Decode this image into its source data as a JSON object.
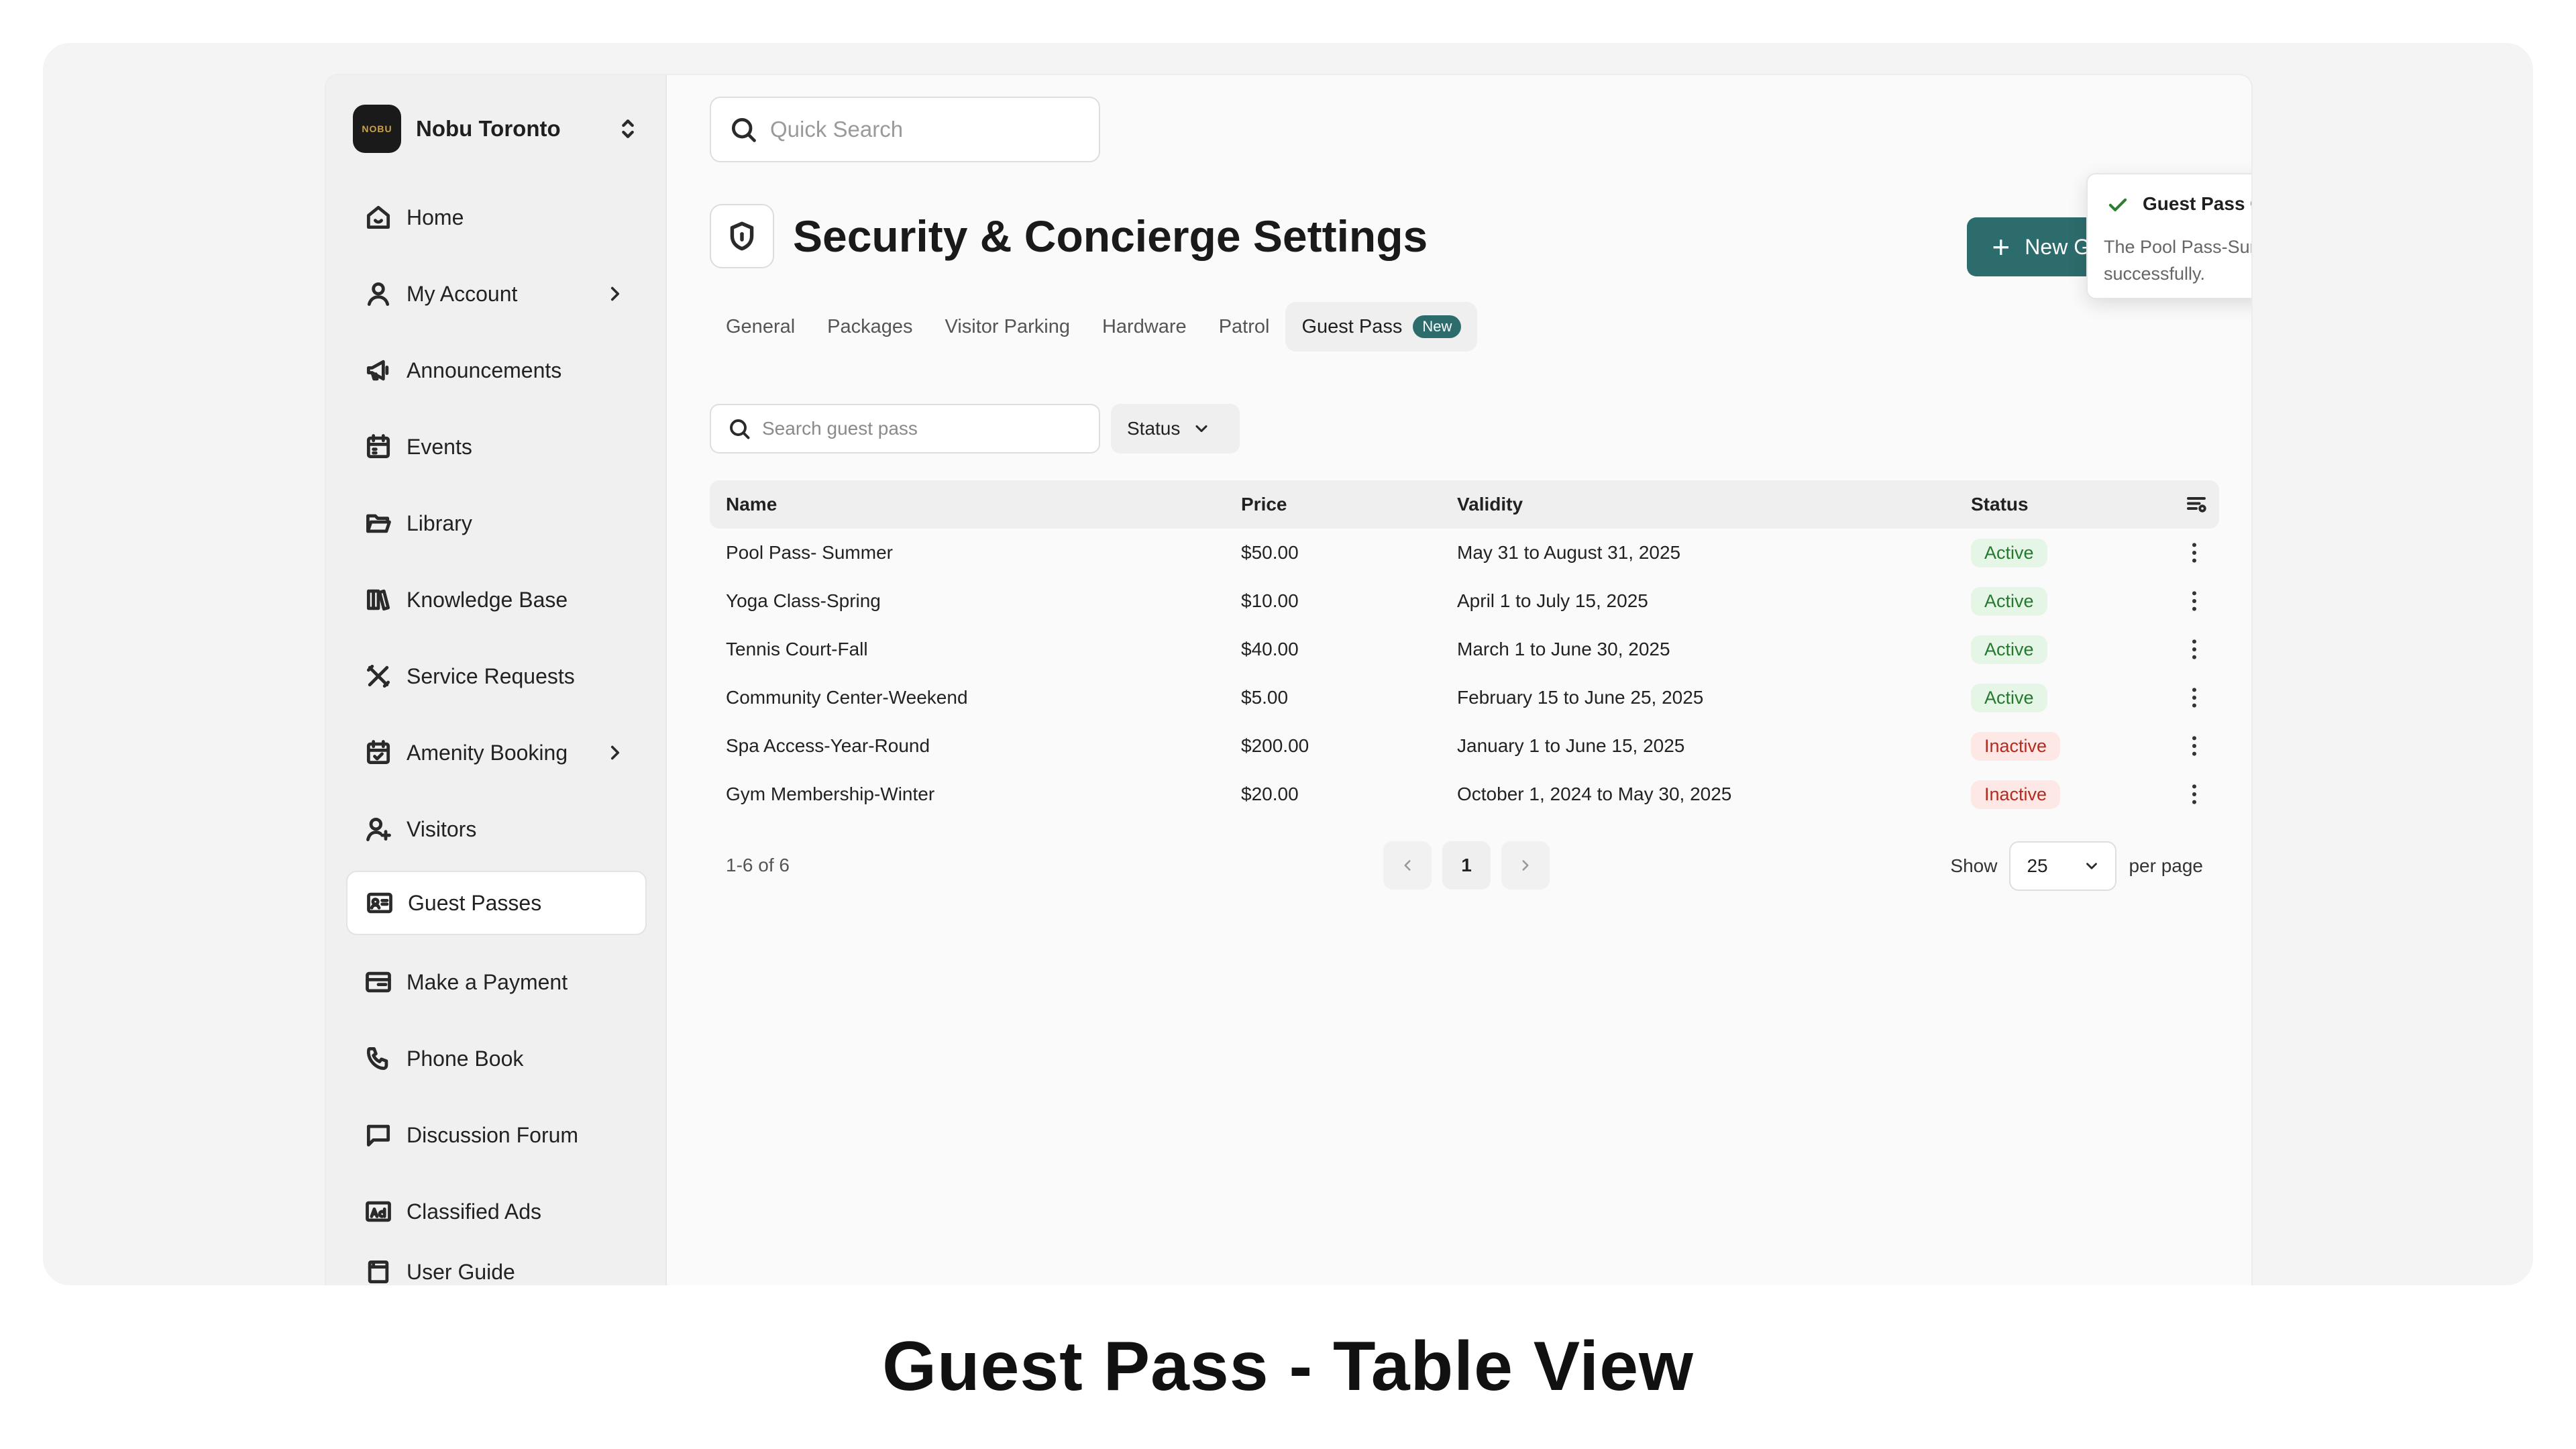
{
  "org": {
    "name": "Nobu Toronto",
    "logo_text": "NOBU"
  },
  "sidebar": {
    "items": [
      {
        "label": "Home",
        "icon": "home-icon",
        "chevron": false,
        "active": false
      },
      {
        "label": "My Account",
        "icon": "user-icon",
        "chevron": true,
        "active": false
      },
      {
        "label": "Announcements",
        "icon": "megaphone-icon",
        "chevron": false,
        "active": false
      },
      {
        "label": "Events",
        "icon": "calendar-icon",
        "chevron": false,
        "active": false
      },
      {
        "label": "Library",
        "icon": "folder-icon",
        "chevron": false,
        "active": false
      },
      {
        "label": "Knowledge Base",
        "icon": "books-icon",
        "chevron": false,
        "active": false
      },
      {
        "label": "Service Requests",
        "icon": "tools-icon",
        "chevron": false,
        "active": false
      },
      {
        "label": "Amenity Booking",
        "icon": "calendar-check-icon",
        "chevron": true,
        "active": false
      },
      {
        "label": "Visitors",
        "icon": "user-plus-icon",
        "chevron": false,
        "active": false
      },
      {
        "label": "Guest Passes",
        "icon": "id-card-icon",
        "chevron": false,
        "active": true
      },
      {
        "label": "Make a Payment",
        "icon": "card-icon",
        "chevron": false,
        "active": false
      },
      {
        "label": "Phone Book",
        "icon": "phone-icon",
        "chevron": false,
        "active": false
      },
      {
        "label": "Discussion Forum",
        "icon": "chat-icon",
        "chevron": false,
        "active": false
      },
      {
        "label": "Classified Ads",
        "icon": "ad-icon",
        "chevron": false,
        "active": false
      },
      {
        "label": "User Guide",
        "icon": "guide-icon",
        "chevron": false,
        "active": false
      }
    ]
  },
  "header": {
    "quick_search_placeholder": "Quick Search",
    "page_title": "Security & Concierge Settings",
    "new_button_label": "New Guest Pass"
  },
  "tabs": [
    {
      "label": "General",
      "active": false
    },
    {
      "label": "Packages",
      "active": false
    },
    {
      "label": "Visitor Parking",
      "active": false
    },
    {
      "label": "Hardware",
      "active": false
    },
    {
      "label": "Patrol",
      "active": false
    },
    {
      "label": "Guest Pass",
      "active": true,
      "badge": "New"
    }
  ],
  "filters": {
    "search_placeholder": "Search guest pass",
    "status_label": "Status"
  },
  "table": {
    "columns": [
      "Name",
      "Price",
      "Validity",
      "Status"
    ],
    "rows": [
      {
        "name": "Pool Pass- Summer",
        "price": "$50.00",
        "validity": "May 31 to August 31, 2025",
        "status": "Active"
      },
      {
        "name": "Yoga Class-Spring",
        "price": "$10.00",
        "validity": "April 1 to July 15, 2025",
        "status": "Active"
      },
      {
        "name": "Tennis Court-Fall",
        "price": "$40.00",
        "validity": "March 1 to June 30, 2025",
        "status": "Active"
      },
      {
        "name": "Community Center-Weekend",
        "price": "$5.00",
        "validity": "February 15 to June 25, 2025",
        "status": "Active"
      },
      {
        "name": "Spa Access-Year-Round",
        "price": "$200.00",
        "validity": "January 1 to June 15, 2025",
        "status": "Inactive"
      },
      {
        "name": "Gym Membership-Winter",
        "price": "$20.00",
        "validity": "October 1, 2024 to May 30, 2025",
        "status": "Inactive"
      }
    ]
  },
  "pagination": {
    "range": "1-6 of 6",
    "current_page": "1",
    "show_label": "Show",
    "per_page_value": "25",
    "per_page_label": "per page"
  },
  "toast": {
    "title": "Guest Pass Created Successfully",
    "body": "The Pool Pass-Summer has been created successfully."
  },
  "caption": "Guest Pass - Table View",
  "colors": {
    "accent": "#2d6c6c",
    "active_text": "#237a2e",
    "active_bg": "#e6f6e6",
    "inactive_text": "#b42a1f",
    "inactive_bg": "#fde8e6"
  }
}
